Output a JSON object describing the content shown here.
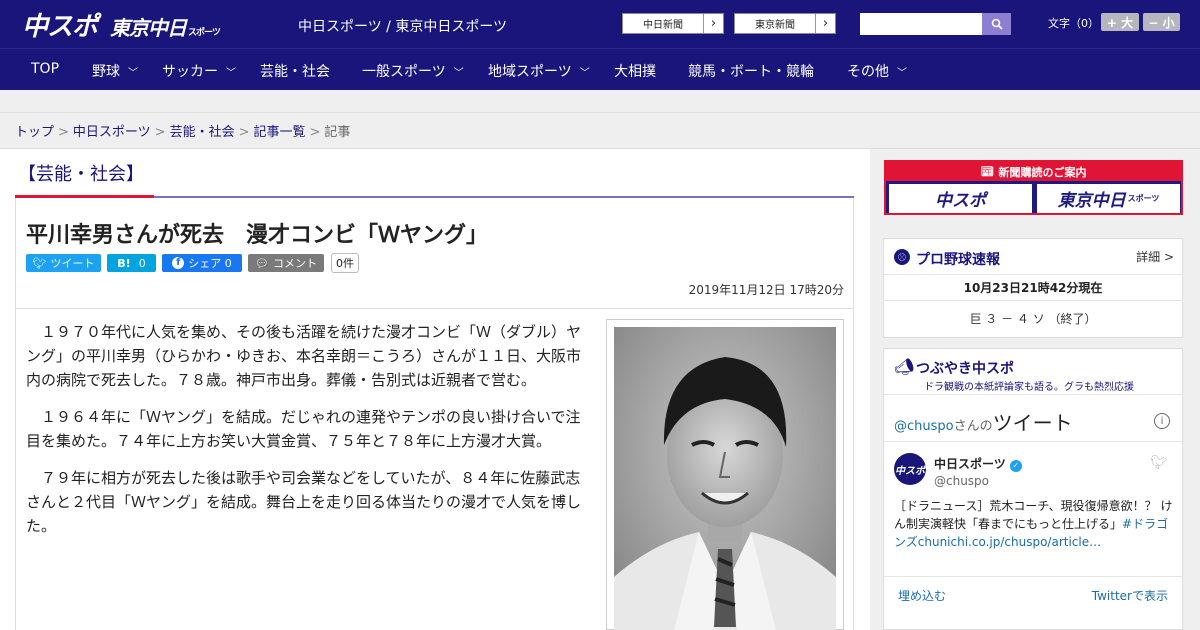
{
  "header": {
    "logo_chuspo": "中スポ",
    "logo_tokyo": "東京中日",
    "logo_tokyo_small": "スポーツ",
    "site_names": "中日スポーツ / 東京中日スポーツ",
    "ext_links": [
      {
        "label": "中日新聞"
      },
      {
        "label": "東京新聞"
      }
    ],
    "search": {
      "placeholder": ""
    },
    "font_size_label": "文字（0）",
    "font_bigger": "+ 大",
    "font_smaller": "− 小"
  },
  "nav": {
    "items": [
      {
        "label": "TOP",
        "dropdown": false
      },
      {
        "label": "野球",
        "dropdown": true
      },
      {
        "label": "サッカー",
        "dropdown": true
      },
      {
        "label": "芸能・社会",
        "dropdown": false
      },
      {
        "label": "一般スポーツ",
        "dropdown": true
      },
      {
        "label": "地域スポーツ",
        "dropdown": true
      },
      {
        "label": "大相撲",
        "dropdown": false
      },
      {
        "label": "競馬・ボート・競輪",
        "dropdown": false
      },
      {
        "label": "その他",
        "dropdown": true
      }
    ]
  },
  "breadcrumb": {
    "items": [
      "トップ",
      "中日スポーツ",
      "芸能・社会",
      "記事一覧"
    ],
    "current": "記事"
  },
  "article": {
    "category": "【芸能・社会】",
    "headline": "平川幸男さんが死去　漫才コンビ「Ｗヤング」",
    "share": {
      "tweet": "ツイート",
      "hatena": "0",
      "hatena_logo": "B!",
      "facebook": "シェア 0",
      "comment": "コメント",
      "comment_count": "0件"
    },
    "date": "2019年11月12日 17時20分",
    "paragraphs": [
      "１９７０年代に人気を集め、その後も活躍を続けた漫才コンビ「Ｗ（ダブル）ヤング」の平川幸男（ひらかわ・ゆきお、本名幸朗＝こうろ）さんが１１日、大阪市内の病院で死去した。７８歳。神戸市出身。葬儀・告別式は近親者で営む。",
      "１９６４年に「Ｗヤング」を結成。だじゃれの連発やテンポの良い掛け合いで注目を集めた。７４年に上方お笑い大賞金賞、７５年と７８年に上方漫才大賞。",
      "７９年に相方が死去した後は歌手や司会業などをしていたが、８４年に佐藤武志さんと２代目「Ｗヤング」を結成。舞台上を走り回る体当たりの漫才で人気を博した。"
    ]
  },
  "sidebar": {
    "subscribe": {
      "title": "新聞購読のご案内",
      "btn1": "中スポ",
      "btn2": "東京中日",
      "btn2_small": "スポーツ"
    },
    "baseball": {
      "title": "プロ野球速報",
      "detail": "詳細 >",
      "time": "10月23日21時42分現在",
      "score": "巨 ３ － ４ ソ （終了）"
    },
    "tweets": {
      "title": "つぶやき中スポ",
      "subtitle": "ドラ観戦の本紙評論家も語る。グラも熱烈応援",
      "user_handle_link": "@chuspo",
      "user_san": "さんの",
      "user_tweet_label": "ツイート",
      "author_name": "中日スポーツ",
      "author_handle": "@chuspo",
      "avatar_text": "中スポ",
      "text": "［ドラニュース］荒木コーチ、現役復帰意欲！？ けん制実演軽快「春までにもっと仕上げる」",
      "text_tag": "#ドラゴンズchunichi.co.jp/chuspo/article…",
      "embed": "埋め込む",
      "view_on_twitter": "Twitterで表示"
    }
  }
}
